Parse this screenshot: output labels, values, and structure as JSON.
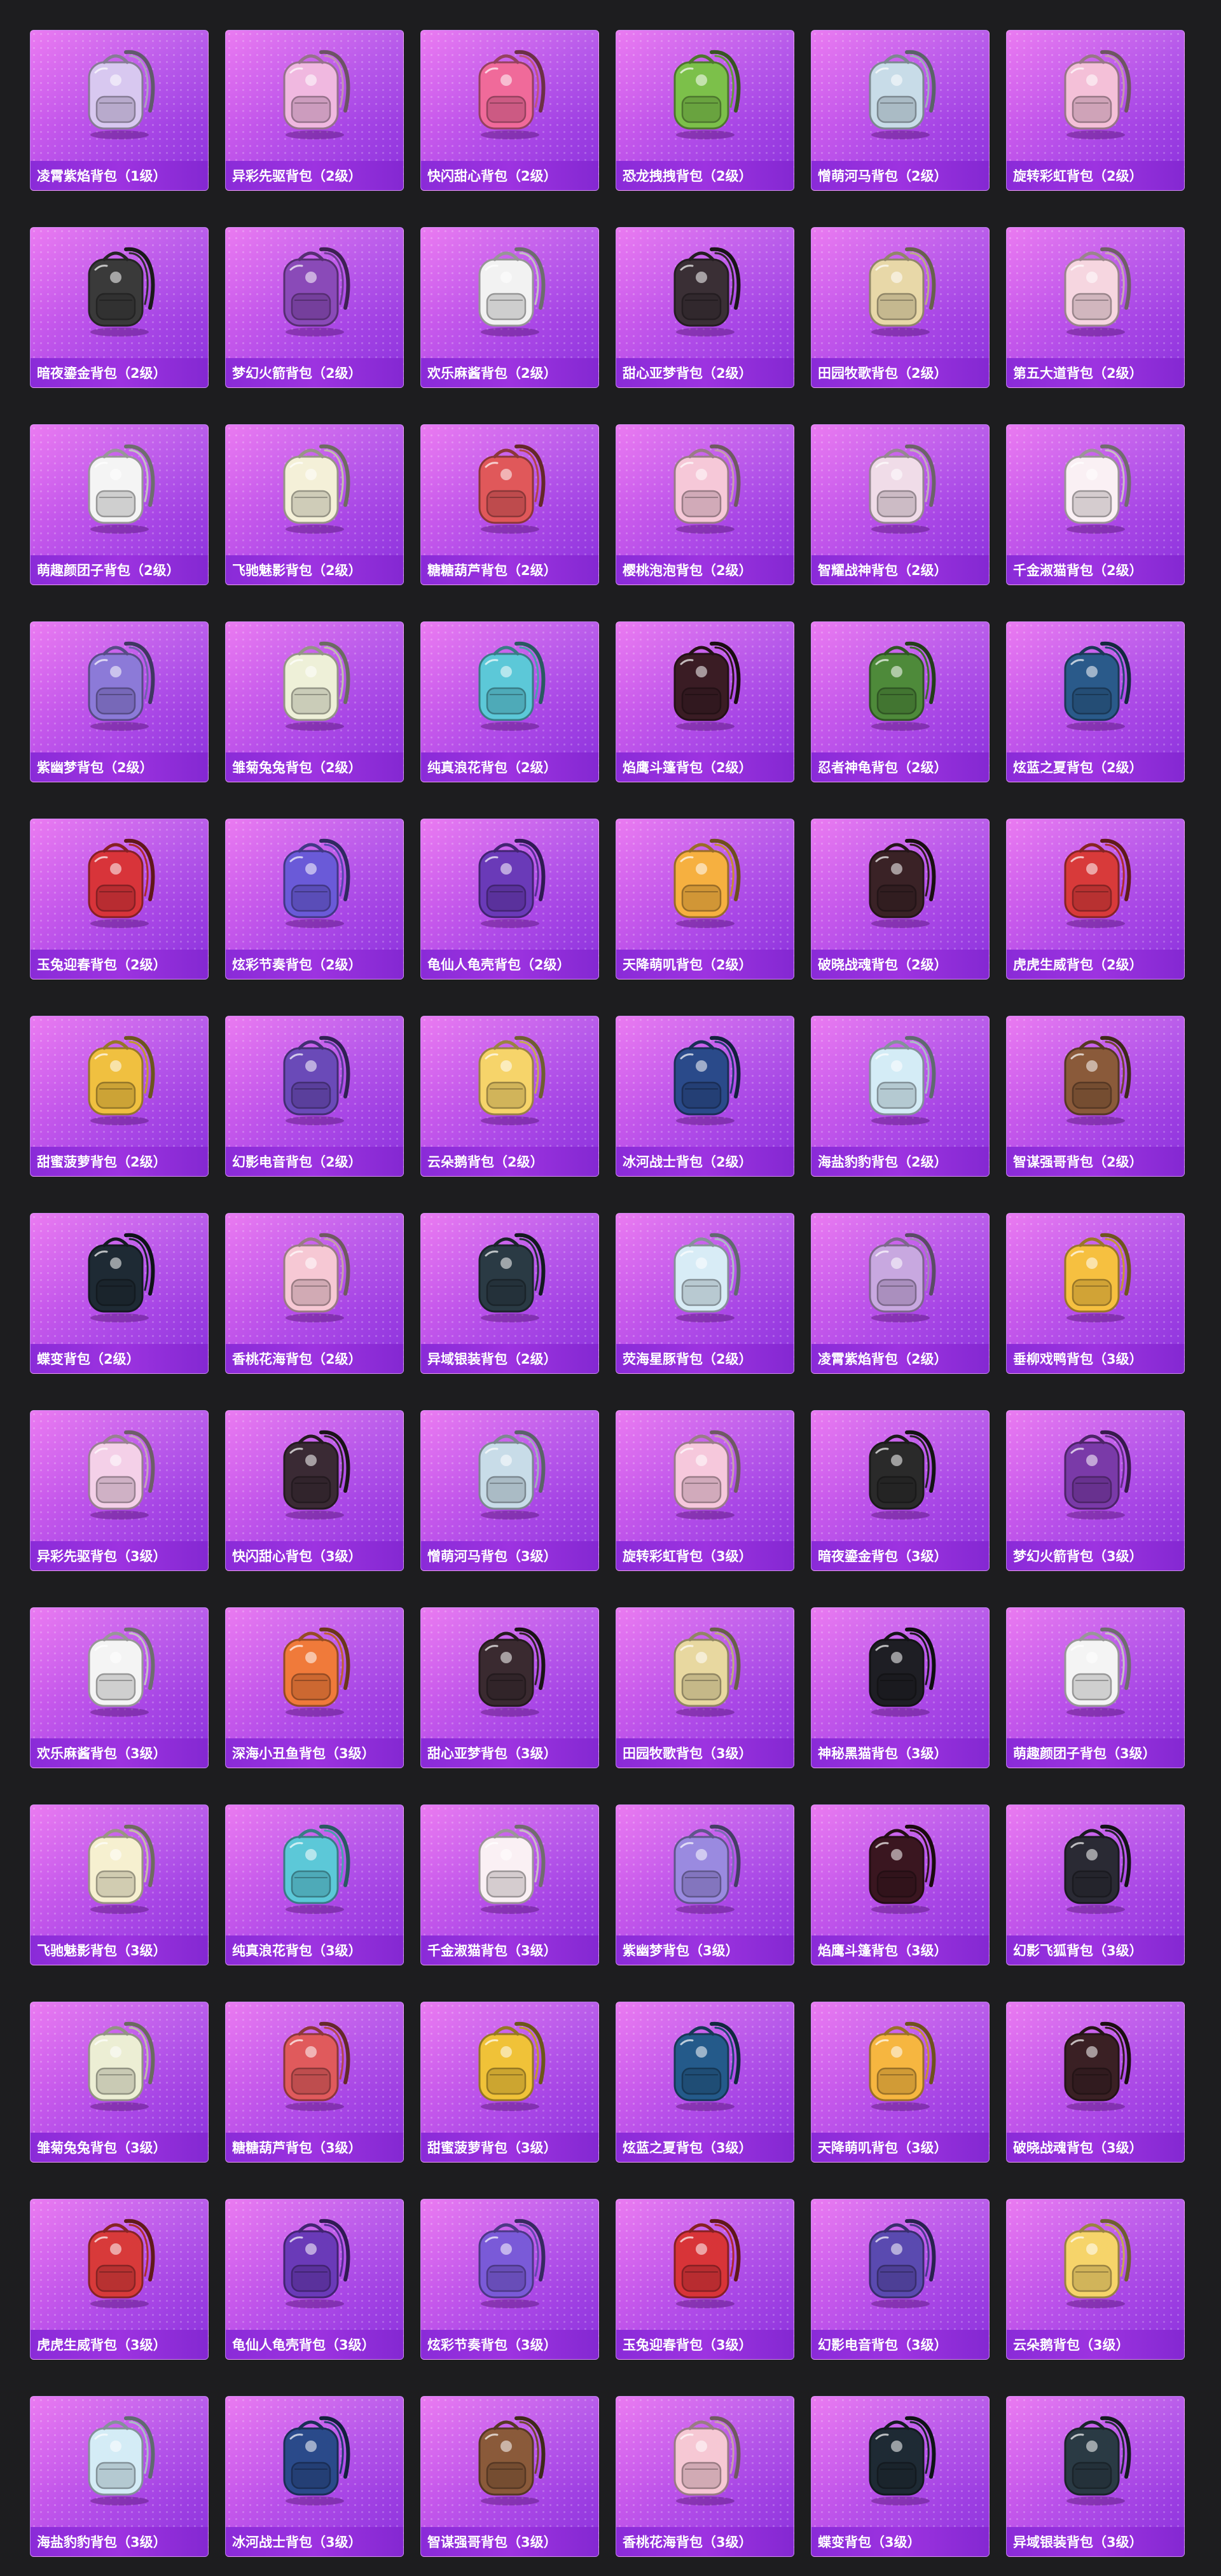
{
  "items": [
    {
      "name": "凌霄紫焰背包（1级）",
      "icon": "backpack-icon",
      "color": "#d8c8f0"
    },
    {
      "name": "异彩先驱背包（2级）",
      "icon": "backpack-icon",
      "color": "#f0b8e0"
    },
    {
      "name": "快闪甜心背包（2级）",
      "icon": "backpack-icon",
      "color": "#f06a9a"
    },
    {
      "name": "恐龙拽拽背包（2级）",
      "icon": "backpack-icon",
      "color": "#7cc04a"
    },
    {
      "name": "憎萌河马背包（2级）",
      "icon": "backpack-icon",
      "color": "#c8dce8"
    },
    {
      "name": "旋转彩虹背包（2级）",
      "icon": "backpack-icon",
      "color": "#f4c0d8"
    },
    {
      "name": "暗夜鎏金背包（2级）",
      "icon": "backpack-icon",
      "color": "#3a3a3a"
    },
    {
      "name": "梦幻火箭背包（2级）",
      "icon": "backpack-icon",
      "color": "#8a4ab8"
    },
    {
      "name": "欢乐麻酱背包（2级）",
      "icon": "backpack-icon",
      "color": "#f2f2f2"
    },
    {
      "name": "甜心亚梦背包（2级）",
      "icon": "backpack-icon",
      "color": "#3a2f35"
    },
    {
      "name": "田园牧歌背包（2级）",
      "icon": "backpack-icon",
      "color": "#e8d8a8"
    },
    {
      "name": "第五大道背包（2级）",
      "icon": "backpack-icon",
      "color": "#f6d6e0"
    },
    {
      "name": "萌趣颜团子背包（2级）",
      "icon": "backpack-icon",
      "color": "#f4f4f4"
    },
    {
      "name": "飞驰魅影背包（2级）",
      "icon": "backpack-icon",
      "color": "#f4f0d8"
    },
    {
      "name": "糖糖葫芦背包（2级）",
      "icon": "backpack-icon",
      "color": "#e0585a"
    },
    {
      "name": "樱桃泡泡背包（2级）",
      "icon": "backpack-icon",
      "color": "#f6c8d8"
    },
    {
      "name": "智耀战神背包（2级）",
      "icon": "backpack-icon",
      "color": "#f0dce8"
    },
    {
      "name": "千金淑猫背包（2级）",
      "icon": "backpack-icon",
      "color": "#faf0f4"
    },
    {
      "name": "紫幽梦背包（2级）",
      "icon": "backpack-icon",
      "color": "#8c7ad8"
    },
    {
      "name": "雏菊兔兔背包（2级）",
      "icon": "backpack-icon",
      "color": "#eef0d8"
    },
    {
      "name": "纯真浪花背包（2级）",
      "icon": "backpack-icon",
      "color": "#5cc8d8"
    },
    {
      "name": "焰鹰斗篷背包（2级）",
      "icon": "backpack-icon",
      "color": "#3a1c24"
    },
    {
      "name": "忍者神龟背包（2级）",
      "icon": "backpack-icon",
      "color": "#4e8a3a"
    },
    {
      "name": "炫蓝之夏背包（2级）",
      "icon": "backpack-icon",
      "color": "#2a5a8a"
    },
    {
      "name": "玉兔迎春背包（2级）",
      "icon": "backpack-icon",
      "color": "#d8343a"
    },
    {
      "name": "炫彩节奏背包（2级）",
      "icon": "backpack-icon",
      "color": "#6a5ad8"
    },
    {
      "name": "龟仙人龟壳背包（2级）",
      "icon": "backpack-icon",
      "color": "#6a3ab8"
    },
    {
      "name": "天降萌叽背包（2级）",
      "icon": "backpack-icon",
      "color": "#f6b040"
    },
    {
      "name": "破晓战魂背包（2级）",
      "icon": "backpack-icon",
      "color": "#3a2226"
    },
    {
      "name": "虎虎生威背包（2级）",
      "icon": "backpack-icon",
      "color": "#d83a3a"
    },
    {
      "name": "甜蜜菠萝背包（2级）",
      "icon": "backpack-icon",
      "color": "#f0c040"
    },
    {
      "name": "幻影电音背包（2级）",
      "icon": "backpack-icon",
      "color": "#6a4ab8"
    },
    {
      "name": "云朵鹅背包（2级）",
      "icon": "backpack-icon",
      "color": "#f6d46a"
    },
    {
      "name": "冰河战士背包（2级）",
      "icon": "backpack-icon",
      "color": "#2a4a8a"
    },
    {
      "name": "海盐豹豹背包（2级）",
      "icon": "backpack-icon",
      "color": "#d4ecf6"
    },
    {
      "name": "智谋强哥背包（2级）",
      "icon": "backpack-icon",
      "color": "#8a5a3a"
    },
    {
      "name": "蝶变背包（2级）",
      "icon": "backpack-icon",
      "color": "#1e2a34"
    },
    {
      "name": "香桃花海背包（2级）",
      "icon": "backpack-icon",
      "color": "#f6c8d4"
    },
    {
      "name": "异域银装背包（2级）",
      "icon": "backpack-icon",
      "color": "#2a3a44"
    },
    {
      "name": "荧海星豚背包（2级）",
      "icon": "backpack-icon",
      "color": "#d8ecf6"
    },
    {
      "name": "凌霄紫焰背包（2级）",
      "icon": "backpack-icon",
      "color": "#c8a8e0"
    },
    {
      "name": "垂柳戏鸭背包（3级）",
      "icon": "backpack-icon",
      "color": "#f6c040"
    },
    {
      "name": "异彩先驱背包（3级）",
      "icon": "backpack-icon",
      "color": "#f4d0e8"
    },
    {
      "name": "快闪甜心背包（3级）",
      "icon": "backpack-icon",
      "color": "#3a2a34"
    },
    {
      "name": "憎萌河马背包（3级）",
      "icon": "backpack-icon",
      "color": "#c8dce8"
    },
    {
      "name": "旋转彩虹背包（3级）",
      "icon": "backpack-icon",
      "color": "#f6c8dc"
    },
    {
      "name": "暗夜鎏金背包（3级）",
      "icon": "backpack-icon",
      "color": "#2a2a2a"
    },
    {
      "name": "梦幻火箭背包（3级）",
      "icon": "backpack-icon",
      "color": "#7a3aa8"
    },
    {
      "name": "欢乐麻酱背包（3级）",
      "icon": "backpack-icon",
      "color": "#f4f4f4"
    },
    {
      "name": "深海小丑鱼背包（3级）",
      "icon": "backpack-icon",
      "color": "#f07a3a"
    },
    {
      "name": "甜心亚梦背包（3级）",
      "icon": "backpack-icon",
      "color": "#3a2a30"
    },
    {
      "name": "田园牧歌背包（3级）",
      "icon": "backpack-icon",
      "color": "#e8d8a0"
    },
    {
      "name": "神秘黑猫背包（3级）",
      "icon": "backpack-icon",
      "color": "#1e1e24"
    },
    {
      "name": "萌趣颜团子背包（3级）",
      "icon": "backpack-icon",
      "color": "#f4f4f4"
    },
    {
      "name": "飞驰魅影背包（3级）",
      "icon": "backpack-icon",
      "color": "#f6f0d0"
    },
    {
      "name": "纯真浪花背包（3级）",
      "icon": "backpack-icon",
      "color": "#5cc8d8"
    },
    {
      "name": "千金淑猫背包（3级）",
      "icon": "backpack-icon",
      "color": "#faf0f4"
    },
    {
      "name": "紫幽梦背包（3级）",
      "icon": "backpack-icon",
      "color": "#9a8ae0"
    },
    {
      "name": "焰鹰斗篷背包（3级）",
      "icon": "backpack-icon",
      "color": "#3a1620"
    },
    {
      "name": "幻影飞狐背包（3级）",
      "icon": "backpack-icon",
      "color": "#2a2a34"
    },
    {
      "name": "雏菊兔兔背包（3级）",
      "icon": "backpack-icon",
      "color": "#eceed4"
    },
    {
      "name": "糖糖葫芦背包（3级）",
      "icon": "backpack-icon",
      "color": "#e05a5c"
    },
    {
      "name": "甜蜜菠萝背包（3级）",
      "icon": "backpack-icon",
      "color": "#f0c238"
    },
    {
      "name": "炫蓝之夏背包（3级）",
      "icon": "backpack-icon",
      "color": "#245a8a"
    },
    {
      "name": "天降萌叽背包（3级）",
      "icon": "backpack-icon",
      "color": "#f6b640"
    },
    {
      "name": "破晓战魂背包（3级）",
      "icon": "backpack-icon",
      "color": "#3a2024"
    },
    {
      "name": "虎虎生威背包（3级）",
      "icon": "backpack-icon",
      "color": "#d83a3a"
    },
    {
      "name": "龟仙人龟壳背包（3级）",
      "icon": "backpack-icon",
      "color": "#6a3ab8"
    },
    {
      "name": "炫彩节奏背包（3级）",
      "icon": "backpack-icon",
      "color": "#7a5ad8"
    },
    {
      "name": "玉兔迎春背包（3级）",
      "icon": "backpack-icon",
      "color": "#d83438"
    },
    {
      "name": "幻影电音背包（3级）",
      "icon": "backpack-icon",
      "color": "#5a4ab0"
    },
    {
      "name": "云朵鹅背包（3级）",
      "icon": "backpack-icon",
      "color": "#f6d46a"
    },
    {
      "name": "海盐豹豹背包（3级）",
      "icon": "backpack-icon",
      "color": "#d4ecf6"
    },
    {
      "name": "冰河战士背包（3级）",
      "icon": "backpack-icon",
      "color": "#2a4a8a"
    },
    {
      "name": "智谋强哥背包（3级）",
      "icon": "backpack-icon",
      "color": "#8a5a3a"
    },
    {
      "name": "香桃花海背包（3级）",
      "icon": "backpack-icon",
      "color": "#f6c8d4"
    },
    {
      "name": "蝶变背包（3级）",
      "icon": "backpack-icon",
      "color": "#1e2a34"
    },
    {
      "name": "异域银装背包（3级）",
      "icon": "backpack-icon",
      "color": "#2a3a44"
    }
  ]
}
